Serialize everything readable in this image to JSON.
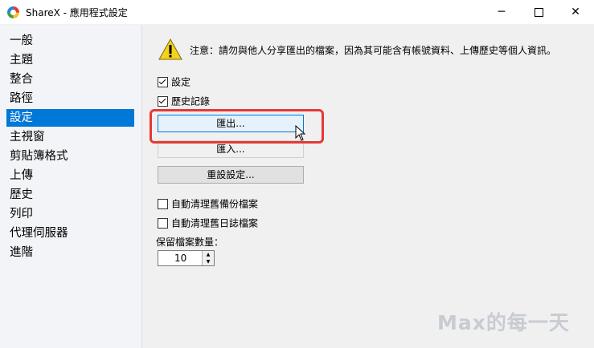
{
  "window": {
    "title": "ShareX - 應用程式設定",
    "minimize": "─",
    "close": "✕"
  },
  "sidebar": {
    "items": [
      {
        "label": "一般"
      },
      {
        "label": "主題"
      },
      {
        "label": "整合"
      },
      {
        "label": "路徑"
      },
      {
        "label": "設定",
        "selected": true
      },
      {
        "label": "主視窗"
      },
      {
        "label": "剪貼簿格式"
      },
      {
        "label": "上傳"
      },
      {
        "label": "歷史"
      },
      {
        "label": "列印"
      },
      {
        "label": "代理伺服器"
      },
      {
        "label": "進階"
      }
    ]
  },
  "main": {
    "notice": "注意：請勿與他人分享匯出的檔案，因為其可能含有帳號資料、上傳歷史等個人資訊。",
    "checkboxes": [
      {
        "label": "設定",
        "checked": true
      },
      {
        "label": "歷史記錄",
        "checked": true
      }
    ],
    "buttons": {
      "export": "匯出...",
      "import": "匯入...",
      "reset": "重設設定..."
    },
    "cleanup": [
      {
        "label": "自動清理舊備份檔案",
        "checked": false
      },
      {
        "label": "自動清理舊日誌檔案",
        "checked": false
      }
    ],
    "keep_count_label": "保留檔案數量：",
    "keep_count_value": "10"
  },
  "colors": {
    "accent": "#0078d7",
    "highlight_box": "#e53935"
  },
  "watermark": "Max的每一天"
}
